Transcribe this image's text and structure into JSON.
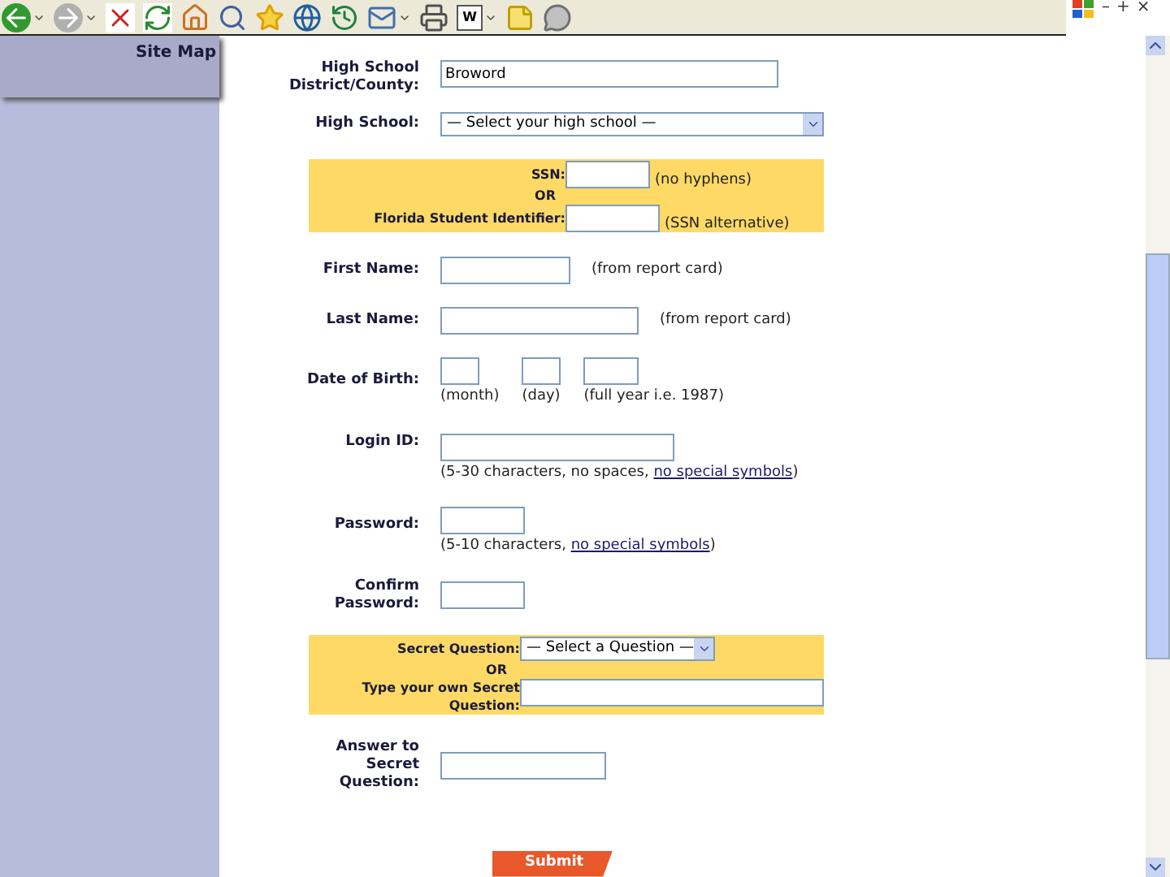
{
  "toolbar": {
    "items": [
      {
        "kind": "back",
        "has_menu": true
      },
      {
        "kind": "forward",
        "has_menu": true
      },
      {
        "kind": "stop",
        "has_menu": false
      },
      {
        "kind": "refresh",
        "has_menu": false
      },
      {
        "kind": "home",
        "has_menu": false
      },
      {
        "kind": "search",
        "has_menu": false
      },
      {
        "kind": "favorites",
        "has_menu": false
      },
      {
        "kind": "media",
        "has_menu": false
      },
      {
        "kind": "history",
        "has_menu": false
      },
      {
        "kind": "mail",
        "has_menu": true
      },
      {
        "kind": "print",
        "has_menu": false
      },
      {
        "kind": "word",
        "label": "W",
        "has_menu": true
      },
      {
        "kind": "note",
        "has_menu": false
      },
      {
        "kind": "messenger",
        "has_menu": false
      }
    ],
    "window_controls": [
      "–",
      "+",
      "×"
    ]
  },
  "sidebar": {
    "link": "Site Map"
  },
  "form": {
    "district": {
      "label": "High School District/County:",
      "value": "Broword"
    },
    "high_school": {
      "label": "High School:",
      "value": "— Select your high school —"
    },
    "id_group": {
      "ssn": {
        "label": "SSN:",
        "hint": "(no hyphens)"
      },
      "or": "OR",
      "fsi": {
        "label": "Florida Student Identifier:",
        "hint": "(SSN alternative)"
      }
    },
    "first_name": {
      "label": "First Name:",
      "hint": "(from report card)"
    },
    "last_name": {
      "label": "Last Name:",
      "hint": "(from report card)"
    },
    "dob": {
      "label": "Date of Birth:",
      "parts": [
        {
          "hint": "(month)"
        },
        {
          "hint": "(day)"
        },
        {
          "hint": "(full year i.e. 1987)"
        }
      ]
    },
    "login": {
      "label": "Login ID:",
      "hint": {
        "before": "(5-30 characters, no spaces, ",
        "link": "no special symbols",
        "after": ")"
      }
    },
    "password": {
      "label": "Password:",
      "hint": {
        "before": "(5-10 characters, ",
        "link": "no special symbols",
        "after": ")"
      }
    },
    "confirm": {
      "label": "Confirm Password:"
    },
    "secret_group": {
      "question": {
        "label": "Secret Question:",
        "value": "— Select a Question —"
      },
      "or": "OR",
      "own": {
        "label": "Type your own Secret Question:"
      }
    },
    "answer": {
      "label": "Answer to Secret Question:"
    },
    "submit": {
      "label": "Submit"
    }
  }
}
